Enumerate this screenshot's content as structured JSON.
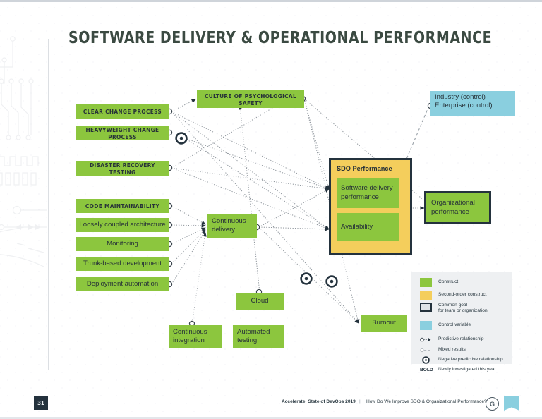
{
  "page": {
    "title": "SOFTWARE DELIVERY & OPERATIONAL PERFORMANCE",
    "number": "31"
  },
  "colors": {
    "construct": "#8CC63E",
    "second_order": "#F4CE5C",
    "control": "#8ACFDF",
    "frame": "#24323d",
    "ink": "#2b3a42"
  },
  "nodes": {
    "clear_change_process": "Clear change process",
    "heavyweight_change_process": "Heavyweight change process",
    "disaster_recovery_testing": "Disaster recovery testing",
    "code_maintainability": "Code maintainability",
    "loosely_coupled_architecture": "Loosely coupled architecture",
    "monitoring": "Monitoring",
    "trunk_based_development": "Trunk-based development",
    "deployment_automation": "Deployment automation",
    "culture_of_psychological_safety": "Culture of psychological safety",
    "continuous_delivery": "Continuous delivery",
    "cloud": "Cloud",
    "continuous_integration": "Continuous integration",
    "automated_testing": "Automated testing",
    "burnout": "Burnout",
    "sdo_performance": "SDO Performance",
    "software_delivery_performance": "Software delivery performance",
    "availability": "Availability",
    "organizational_performance": "Organizational performance",
    "industry_control": "Industry (control)",
    "enterprise_control": "Enterprise (control)"
  },
  "legend": {
    "items": [
      {
        "symbol": "green-swatch",
        "label": "Construct"
      },
      {
        "symbol": "yellow-swatch",
        "label": "Second-order construct"
      },
      {
        "symbol": "framed-swatch",
        "label": "Common goal\nfor team or organization"
      },
      {
        "symbol": "blue-swatch",
        "label": "Control variable"
      },
      {
        "symbol": "dotted-arrow",
        "label": "Predictive relationship"
      },
      {
        "symbol": "dashed-line",
        "label": "Mixed results"
      },
      {
        "symbol": "ring-dot",
        "label": "Negative predictive relationship"
      },
      {
        "symbol": "bold-text",
        "label": "Newly investigated this year",
        "key": "BOLD"
      }
    ],
    "common_goal_line1": "Common goal",
    "common_goal_line2": "for team or organization"
  },
  "footer": {
    "report": "Accelerate: State of DevOps 2019",
    "separator": "|",
    "question": "How Do We Improve SDO & Organizational Performance?",
    "logo_letter": "G"
  }
}
